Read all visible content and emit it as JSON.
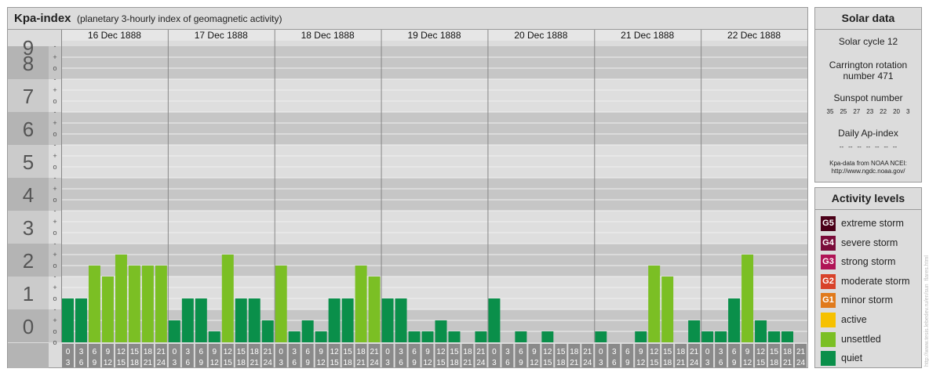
{
  "header": {
    "title": "Kpa-index",
    "subtitle": "(planetary 3-hourly index of geomagnetic activity)"
  },
  "chart_data": {
    "type": "bar",
    "title": "Kpa-index",
    "subtitle": "(planetary 3-hourly index of geomagnetic activity)",
    "ylim": [
      0,
      9
    ],
    "y_ticks": [
      "0",
      "1",
      "2",
      "3",
      "4",
      "5",
      "6",
      "7",
      "8",
      "9"
    ],
    "minor_ticks": [
      "-",
      "o",
      "+"
    ],
    "days": [
      "16 Dec 1888",
      "17 Dec 1888",
      "18 Dec 1888",
      "19 Dec 1888",
      "20 Dec 1888",
      "21 Dec 1888",
      "22 Dec 1888"
    ],
    "interval_labels": [
      [
        "0",
        "3"
      ],
      [
        "3",
        "6"
      ],
      [
        "6",
        "9"
      ],
      [
        "9",
        "12"
      ],
      [
        "12",
        "15"
      ],
      [
        "15",
        "18"
      ],
      [
        "18",
        "21"
      ],
      [
        "21",
        "24"
      ]
    ],
    "values": [
      [
        1.333,
        1.333,
        2.333,
        2.0,
        2.667,
        2.333,
        2.333,
        2.333
      ],
      [
        0.667,
        1.333,
        1.333,
        0.333,
        2.667,
        1.333,
        1.333,
        0.667
      ],
      [
        2.333,
        0.333,
        0.667,
        0.333,
        1.333,
        1.333,
        2.333,
        2.0
      ],
      [
        1.333,
        1.333,
        0.333,
        0.333,
        0.667,
        0.333,
        0,
        0.333
      ],
      [
        1.333,
        0,
        0.333,
        0,
        0.333,
        0,
        0,
        0
      ],
      [
        0.333,
        0,
        0,
        0.333,
        2.333,
        2.0,
        0,
        0.667
      ],
      [
        0.333,
        0.333,
        1.333,
        2.667,
        0.667,
        0.333,
        0.333,
        0
      ]
    ],
    "series": [
      {
        "name": "quiet",
        "color": "#0a8f4a"
      },
      {
        "name": "unsettled",
        "color": "#7bbf24"
      }
    ]
  },
  "solar": {
    "title": "Solar data",
    "cycle": "Solar cycle 12",
    "carrington": [
      "Carrington rotation",
      "number 471"
    ],
    "sunspot_title": "Sunspot number",
    "sunspots": [
      "35",
      "25",
      "27",
      "23",
      "22",
      "20",
      "3"
    ],
    "ap_title": "Daily Ap-index",
    "ap_values": [
      "--",
      "--",
      "--",
      "--",
      "--",
      "--",
      "--"
    ],
    "source": [
      "Kpa-data from NOAA NCEI:",
      "http://www.ngdc.noaa.gov/"
    ]
  },
  "activity": {
    "title": "Activity levels",
    "levels": [
      {
        "badge": "G5",
        "label": "extreme storm",
        "color": "#4a0018"
      },
      {
        "badge": "G4",
        "label": "severe storm",
        "color": "#7a0c3a"
      },
      {
        "badge": "G3",
        "label": "strong storm",
        "color": "#b01456"
      },
      {
        "badge": "G2",
        "label": "moderate storm",
        "color": "#d8422a"
      },
      {
        "badge": "G1",
        "label": "minor storm",
        "color": "#e07a1c"
      },
      {
        "badge": "",
        "label": "active",
        "color": "#f6c100"
      },
      {
        "badge": "",
        "label": "unsettled",
        "color": "#7bbf24"
      },
      {
        "badge": "",
        "label": "quiet",
        "color": "#0a8f4a"
      }
    ]
  },
  "credit": "http://www.tesis.lebedev.ru/en/sun_flares.html"
}
